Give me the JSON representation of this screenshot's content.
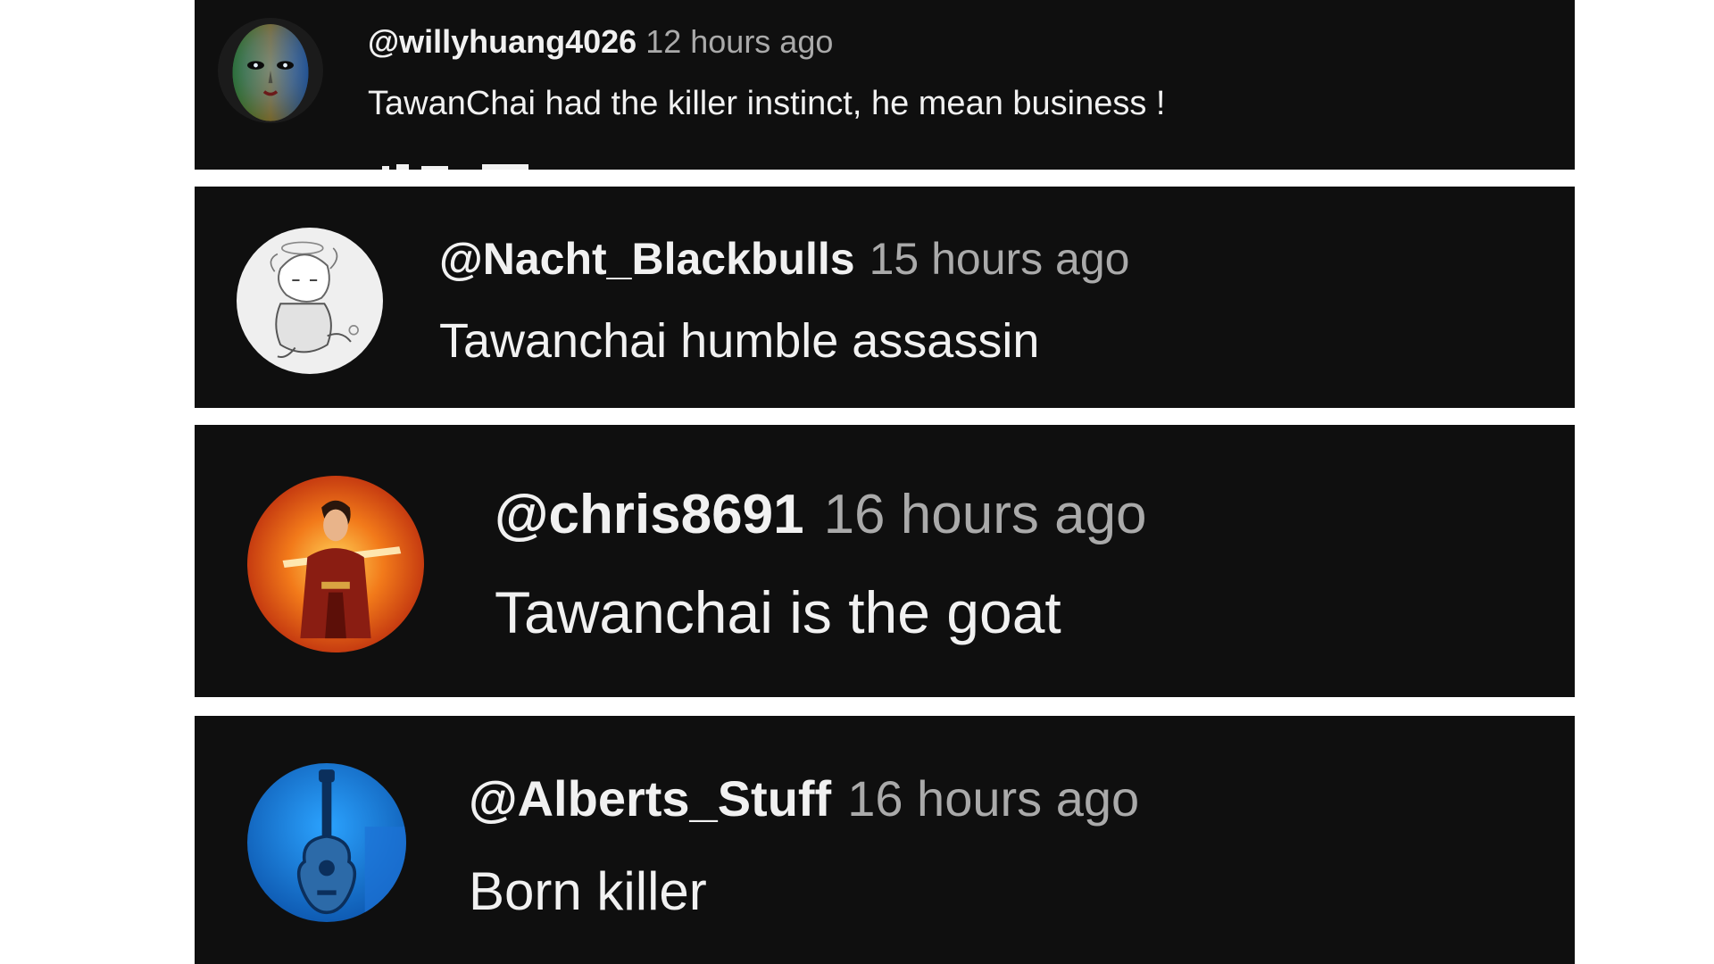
{
  "comments": [
    {
      "handle": "@willyhuang4026",
      "time": "12 hours ago",
      "text": "TawanChai had the killer instinct, he mean business !"
    },
    {
      "handle": "@Nacht_Blackbulls",
      "time": "15 hours ago",
      "text": "Tawanchai humble assassin"
    },
    {
      "handle": "@chris8691",
      "time": "16 hours ago",
      "text": "Tawanchai is the goat"
    },
    {
      "handle": "@Alberts_Stuff",
      "time": "16 hours ago",
      "text": "Born killer"
    }
  ],
  "colors": {
    "card_background": "#0f0f0f",
    "handle_text": "#f1f1f1",
    "time_text": "#aaaaaa",
    "page_background": "#ffffff"
  }
}
